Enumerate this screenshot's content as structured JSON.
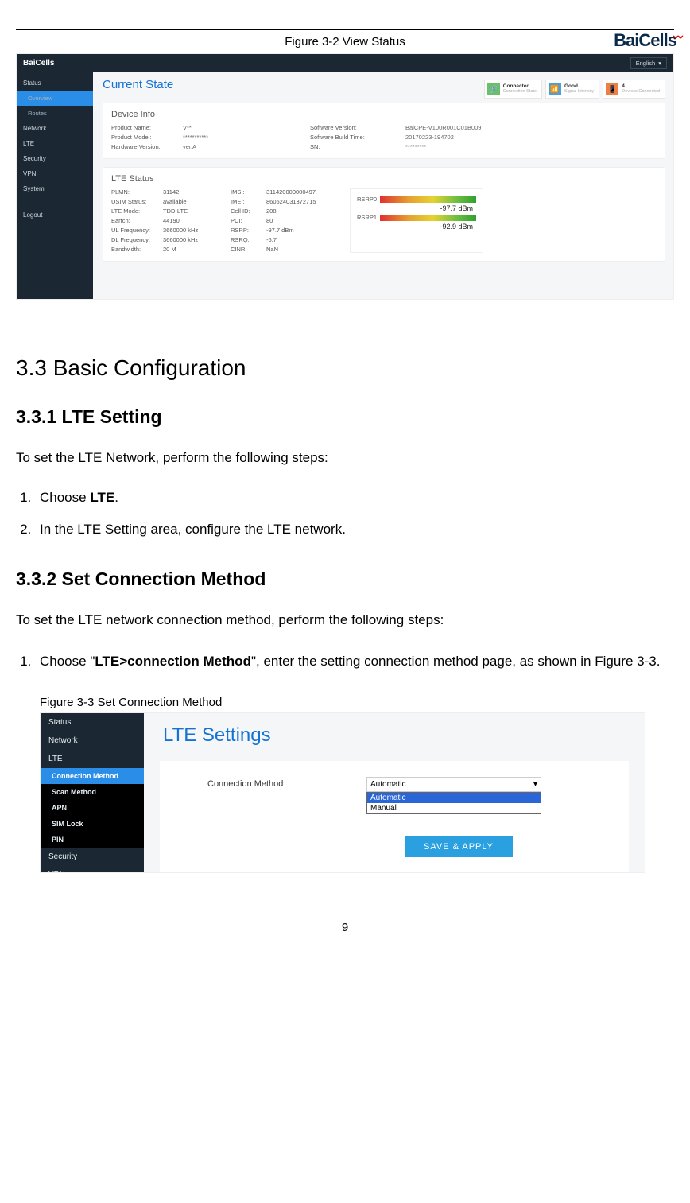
{
  "header": {
    "logo_text": "BaiCells"
  },
  "fig1": {
    "caption": "Figure 3-2 View Status",
    "logo": "BaiCells",
    "sidebar": [
      "Status",
      "Overview",
      "Routes",
      "Network",
      "LTE",
      "Security",
      "VPN",
      "System",
      "Logout"
    ],
    "language": "English",
    "page_title": "Current State",
    "tiles": [
      {
        "title": "Connected",
        "sub": "Connection State"
      },
      {
        "title": "Good",
        "sub": "Signal Intensity"
      },
      {
        "title": "4",
        "sub": "Devices Connected"
      }
    ],
    "device_info": {
      "title": "Device Info",
      "rows": [
        [
          "Product Name:",
          "V**",
          "Software Version:",
          "BaiCPE-V100R001C01B009"
        ],
        [
          "Product Model:",
          "***********",
          "Software Build Time:",
          "20170223-194702"
        ],
        [
          "Hardware Version:",
          "ver.A",
          "SN:",
          "*********"
        ]
      ]
    },
    "lte_status": {
      "title": "LTE Status",
      "rows": [
        [
          "PLMN:",
          "31142",
          "IMSI:",
          "311420000000497"
        ],
        [
          "USIM Status:",
          "available",
          "IMEI:",
          "860524031372715"
        ],
        [
          "LTE Mode:",
          "TDD-LTE",
          "Cell ID:",
          "208"
        ],
        [
          "Earfcn:",
          "44190",
          "PCI:",
          "80"
        ],
        [
          "UL Frequency:",
          "3660000 kHz",
          "RSRP:",
          "-97.7 dBm"
        ],
        [
          "DL Frequency:",
          "3660000 kHz",
          "RSRQ:",
          "-6.7"
        ],
        [
          "Bandwidth:",
          "20 M",
          "CINR:",
          "NaN"
        ]
      ],
      "rsrp": [
        {
          "label": "RSRP0",
          "value": "-97.7 dBm"
        },
        {
          "label": "RSRP1",
          "value": "-92.9 dBm"
        }
      ]
    }
  },
  "sections": {
    "h33": "3.3    Basic Configuration",
    "h331": "3.3.1 LTE Setting",
    "p1": "To set the LTE Network, perform the following steps:",
    "steps1": {
      "s1_pre": "Choose ",
      "s1_bold": "LTE",
      "s1_post": ".",
      "s2": "In the LTE Setting area, configure the LTE network."
    },
    "h332": "3.3.2 Set Connection Method",
    "p2": "To set the LTE network connection method, perform the following steps:",
    "steps2": {
      "s1_pre": "Choose \"",
      "s1_bold": "LTE>connection Method",
      "s1_mid": "\", enter the setting connection method page, as shown in ",
      "s1_fig": "Figure 3-3",
      "s1_post": "."
    }
  },
  "fig2": {
    "caption": "Figure 3-3 Set Connection Method",
    "sidebar_top": [
      "Status",
      "Network",
      "LTE"
    ],
    "sidebar_sub": [
      "Connection Method",
      "Scan Method",
      "APN",
      "SIM Lock",
      "PIN"
    ],
    "sidebar_bottom": [
      "Security",
      "VPN"
    ],
    "page_title": "LTE Settings",
    "field_label": "Connection Method",
    "selected": "Automatic",
    "options": [
      "Automatic",
      "Manual"
    ],
    "button": "SAVE & APPLY"
  },
  "pagenum": "9"
}
